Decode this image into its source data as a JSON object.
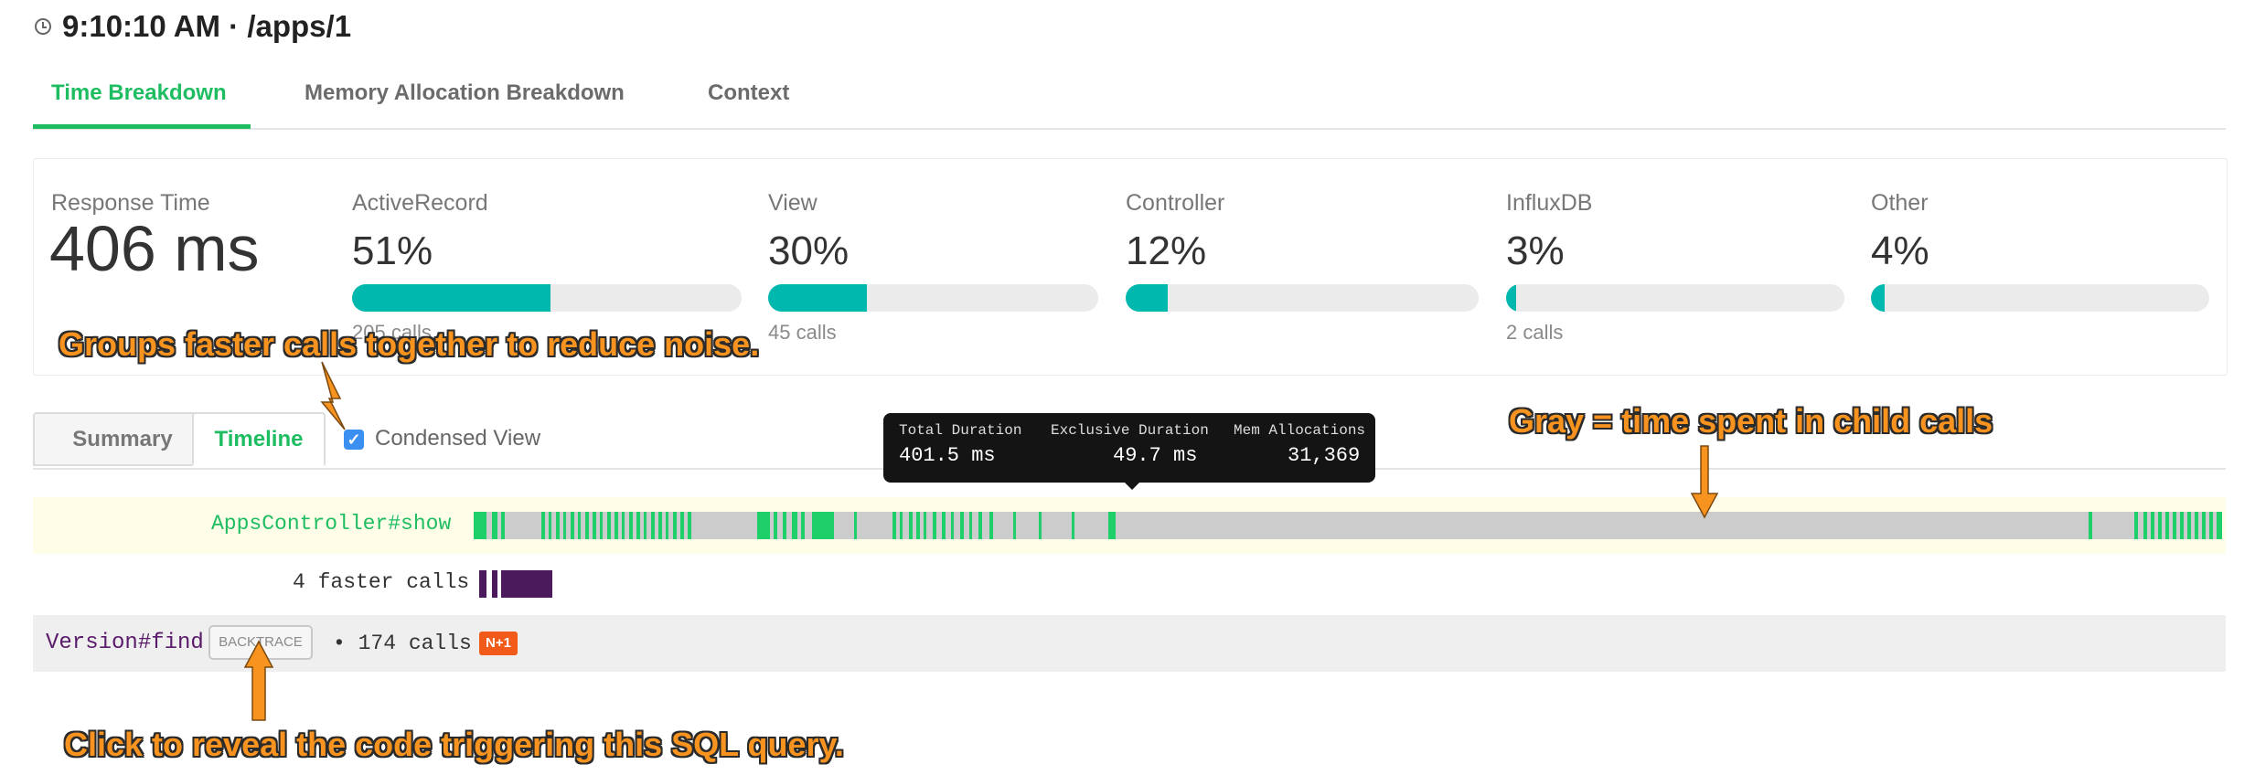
{
  "header": {
    "title": "9:10:10 AM · /apps/1"
  },
  "tabs": [
    {
      "label": "Time Breakdown",
      "active": true
    },
    {
      "label": "Memory Allocation Breakdown",
      "active": false
    },
    {
      "label": "Context",
      "active": false
    }
  ],
  "summary": {
    "response_label": "Response Time",
    "response_value": "406 ms",
    "metrics": [
      {
        "label": "ActiveRecord",
        "value": "51%",
        "fraction": 0.51,
        "calls": "205 calls"
      },
      {
        "label": "View",
        "value": "30%",
        "fraction": 0.3,
        "calls": "45 calls"
      },
      {
        "label": "Controller",
        "value": "12%",
        "fraction": 0.12,
        "calls": ""
      },
      {
        "label": "InfluxDB",
        "value": "3%",
        "fraction": 0.03,
        "calls": "2 calls"
      },
      {
        "label": "Other",
        "value": "4%",
        "fraction": 0.04,
        "calls": ""
      }
    ],
    "bar_color": "#00b8ad"
  },
  "view_toggle": {
    "summary_label": "Summary",
    "timeline_label": "Timeline",
    "active": "Timeline"
  },
  "condensed": {
    "label": "Condensed View",
    "checked": true
  },
  "tooltip": {
    "total_label": "Total Duration",
    "total_value": "401.5 ms",
    "exclusive_label": "Exclusive Duration",
    "exclusive_value": "49.7 ms",
    "mem_label": "Mem Allocations",
    "mem_value": "31,369"
  },
  "timeline": {
    "controller_row": {
      "name": "AppsController#show",
      "color": "#1fcf6a",
      "child_color": "#cccccc"
    },
    "faster_row": {
      "label": "4 faster calls",
      "color": "#4b1a5c"
    },
    "query_row": {
      "name": "Version#find",
      "backtrace_label": "BACKTRACE",
      "calls_label": "• 174 calls",
      "badge": "N+1",
      "color": "#5a1a6a"
    }
  },
  "annotations": {
    "groups": "Groups faster calls together to reduce noise.",
    "gray": "Gray = time spent in child calls",
    "click": "Click to reveal the code triggering this SQL query."
  },
  "colors": {
    "accent": "#1fbd62",
    "annotation": "#f7931e",
    "n_plus_one": "#f25a1a"
  }
}
